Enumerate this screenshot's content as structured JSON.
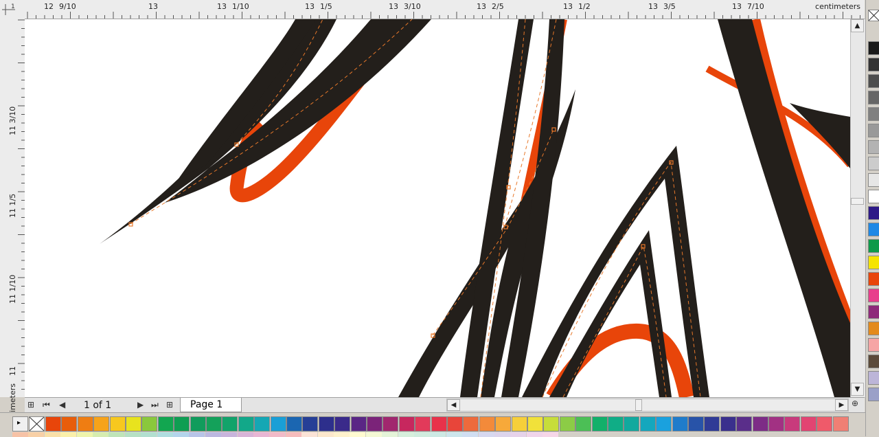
{
  "rulers": {
    "unit_label": "centimeters",
    "horizontal_labels": [
      {
        "a": "12",
        "b": "9/10"
      },
      {
        "a": "13",
        "b": ""
      },
      {
        "a": "13",
        "b": "1/10"
      },
      {
        "a": "13",
        "b": "1/5"
      },
      {
        "a": "13",
        "b": "3/10"
      },
      {
        "a": "13",
        "b": "2/5"
      },
      {
        "a": "13",
        "b": "1/2"
      },
      {
        "a": "13",
        "b": "3/5"
      },
      {
        "a": "13",
        "b": "7/10"
      }
    ],
    "vertical_labels": [
      "11 3/10",
      "11 1/5",
      "11 1/10",
      "11"
    ],
    "vertical_unit_label": "centimeters"
  },
  "status": {
    "page_of": "1 of 1",
    "page_tab": "Page 1"
  },
  "icons": {
    "add_page_before": "add-page-icon",
    "first_page": "first-page-icon",
    "prev_page": "prev-page-icon",
    "next_page": "next-page-icon",
    "last_page": "last-page-icon",
    "add_page_after": "add-page-icon",
    "no_fill": "no-fill-icon",
    "zoom": "zoom-icon"
  },
  "colors": {
    "accent_orange": "#e8450a",
    "stroke_black": "#231f1b",
    "guide_orange": "#e8782a"
  },
  "palette_vertical": [
    "#1a1a1a",
    "#333333",
    "#4d4d4d",
    "#666666",
    "#808080",
    "#999999",
    "#b3b3b3",
    "#cccccc",
    "#e6e6e6",
    "#ffffff",
    "#2e1a87",
    "#1e88e5",
    "#0d9a4a",
    "#f5e400",
    "#e8450a",
    "#e83e8c",
    "#8e2a7a",
    "#e38a1c",
    "#f6a5a5",
    "#5b4a3a",
    "#bcb5d8",
    "#9aa0c8"
  ],
  "palette_bottom": [
    "#e8450a",
    "#e85d0a",
    "#ef7d12",
    "#f6a31a",
    "#f7c81e",
    "#e8e31e",
    "#8ac83c",
    "#12a650",
    "#0f9e52",
    "#119c5c",
    "#14a15a",
    "#12a36a",
    "#12a889",
    "#15a7b4",
    "#1a9fd6",
    "#1b66b1",
    "#263f96",
    "#2d2f8c",
    "#3a2a8a",
    "#5a2685",
    "#7b2379",
    "#a1276e",
    "#c7275e",
    "#e23a5a",
    "#e8324a",
    "#e8453a",
    "#ed6a3c",
    "#f38a3a",
    "#f7a93a",
    "#f6cf3a",
    "#f1e13a",
    "#c7dd3a",
    "#8ccc46",
    "#4cbf56",
    "#12b06a",
    "#10ad86",
    "#12a99e",
    "#14a7bd",
    "#1aa1de",
    "#1f7ccb",
    "#2853a8",
    "#303b96",
    "#3a308d",
    "#5a2e8a",
    "#7d2c86",
    "#a23183",
    "#c83a7c",
    "#e24472",
    "#ef5a6a",
    "#f07f74"
  ],
  "palette_bottom_row2": [
    "#f6c2a6",
    "#f8d0a6",
    "#f9e0a8",
    "#faf0aa",
    "#eef4ac",
    "#d6ecb0",
    "#bfe4b8",
    "#b6e0c4",
    "#b2dfd0",
    "#b0dde0",
    "#b4d4ec",
    "#b8c4e8",
    "#bcb8e0",
    "#c8b4dc",
    "#d8b4d8",
    "#e8b6d4",
    "#f2bac8",
    "#f6bcbc",
    "#fbe3d6",
    "#fde8cc",
    "#fff2cc",
    "#fffbd0",
    "#f4f9d4",
    "#e4f4d8",
    "#d6efdc",
    "#d0ecde",
    "#cce9e4",
    "#cce5ec",
    "#d0def2",
    "#d6d8f0",
    "#dcd4ec",
    "#e6d2ea",
    "#f0d4ea",
    "#f6d6e8"
  ]
}
